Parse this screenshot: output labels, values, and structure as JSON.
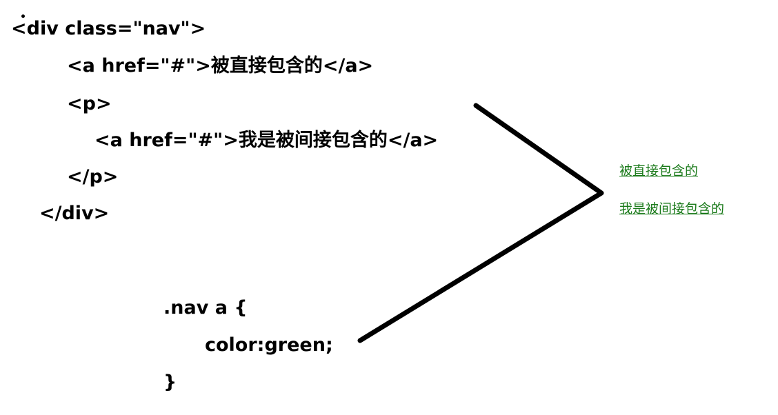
{
  "html_code": {
    "lines": [
      "<div class=\"nav\">",
      "<a href=\"#\">被直接包含的</a>",
      "<p>",
      "<a href=\"#\">我是被间接包含的</a>",
      "</p>",
      "</div>"
    ]
  },
  "css_code": {
    "lines": [
      ".nav a {",
      "color:green;",
      "}"
    ]
  },
  "rendered_result": {
    "links": [
      "被直接包含的",
      "我是被间接包含的"
    ],
    "link_color": "#1a7a1a"
  },
  "icons": {
    "connector": "angle-bracket-arrow-icon"
  }
}
